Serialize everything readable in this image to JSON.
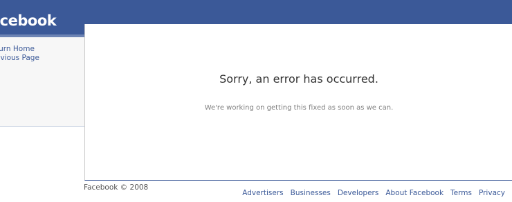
{
  "header": {
    "logo_text": "acebook"
  },
  "sidebar": {
    "links": [
      {
        "label": "turn Home"
      },
      {
        "label": "evious Page"
      }
    ]
  },
  "error": {
    "title": "Sorry, an error has occurred.",
    "message": "We're working on getting this fixed as soon as we can."
  },
  "footer": {
    "copyright": "Facebook © 2008",
    "links": [
      {
        "label": "Advertisers"
      },
      {
        "label": "Businesses"
      },
      {
        "label": "Developers"
      },
      {
        "label": "About Facebook"
      },
      {
        "label": "Terms"
      },
      {
        "label": "Privacy"
      }
    ]
  },
  "colors": {
    "brand_blue": "#3b5998",
    "link_blue": "#3b5998",
    "sidebar_bg": "#f7f7f7"
  }
}
